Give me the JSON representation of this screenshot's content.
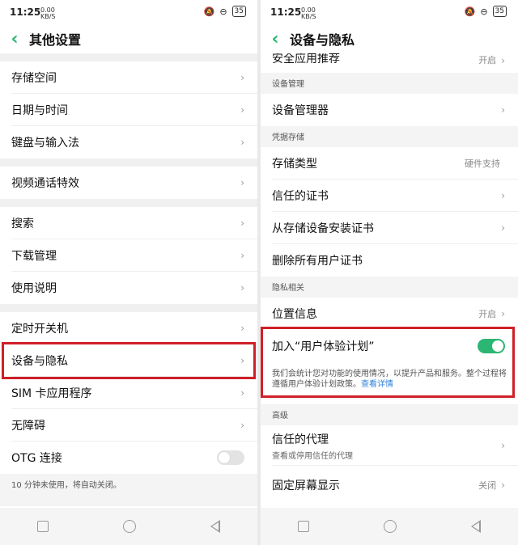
{
  "left": {
    "status": {
      "time": "11:25",
      "signal": "0.00 KB/S",
      "battery": "35"
    },
    "title": "其他设置",
    "items": [
      {
        "label": "存储空间"
      },
      {
        "label": "日期与时间"
      },
      {
        "label": "键盘与输入法"
      },
      {
        "label": "视频通话特效"
      },
      {
        "label": "搜索"
      },
      {
        "label": "下载管理"
      },
      {
        "label": "使用说明"
      },
      {
        "label": "定时开关机"
      },
      {
        "label": "设备与隐私"
      },
      {
        "label": "SIM 卡应用程序"
      },
      {
        "label": "无障碍"
      },
      {
        "label": "OTG 连接",
        "toggle": "off"
      }
    ],
    "footer_note": "10 分钟未使用，将自动关闭。"
  },
  "right": {
    "status": {
      "time": "11:25",
      "signal": "0.00 KB/S",
      "battery": "35"
    },
    "title": "设备与隐私",
    "partial_item": {
      "label": "安全应用推荐",
      "value": "开启"
    },
    "section_device": "设备管理",
    "device_manager": "设备管理器",
    "section_credentials": "凭据存储",
    "storage_type": {
      "label": "存储类型",
      "value": "硬件支持"
    },
    "trusted_certs": "信任的证书",
    "install_certs": "从存储设备安装证书",
    "delete_certs": "删除所有用户证书",
    "section_privacy": "隐私相关",
    "location": {
      "label": "位置信息",
      "value": "开启"
    },
    "ux_plan": {
      "label": "加入“用户体验计划”",
      "toggle": "on"
    },
    "ux_note": "我们会统计您对功能的使用情况，以提升产品和服务。整个过程将遵循用户体验计划政策。",
    "ux_link": "查看详情",
    "section_advanced": "高级",
    "trust_agents": {
      "label": "信任的代理",
      "sub": "查看或停用信任的代理"
    },
    "screen_pin": {
      "label": "固定屏幕显示",
      "value": "关闭"
    }
  },
  "colors": {
    "accent": "#2bb673",
    "highlight": "#cf2029",
    "link": "#2d7fd8"
  }
}
